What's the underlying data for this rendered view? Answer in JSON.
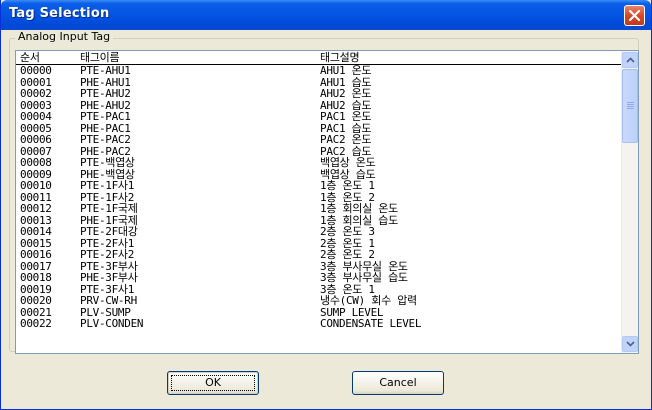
{
  "window": {
    "title": "Tag Selection"
  },
  "group": {
    "label": "Analog Input Tag"
  },
  "list": {
    "columns": [
      "순서",
      "태그이름",
      "태그설명"
    ],
    "rows": [
      [
        "00000",
        "PTE-AHU1",
        "AHU1 온도"
      ],
      [
        "00001",
        "PHE-AHU1",
        "AHU1 습도"
      ],
      [
        "00002",
        "PTE-AHU2",
        "AHU2 온도"
      ],
      [
        "00003",
        "PHE-AHU2",
        "AHU2 습도"
      ],
      [
        "00004",
        "PTE-PAC1",
        "PAC1 온도"
      ],
      [
        "00005",
        "PHE-PAC1",
        "PAC1 습도"
      ],
      [
        "00006",
        "PTE-PAC2",
        "PAC2 온도"
      ],
      [
        "00007",
        "PHE-PAC2",
        "PAC2 습도"
      ],
      [
        "00008",
        "PTE-백엽상",
        "백엽상 온도"
      ],
      [
        "00009",
        "PHE-백엽상",
        "백엽상 습도"
      ],
      [
        "00010",
        "PTE-1F사1",
        "1층 온도 1"
      ],
      [
        "00011",
        "PTE-1F사2",
        "1층 온도 2"
      ],
      [
        "00012",
        "PTE-1F국제",
        "1층 회의실 온도"
      ],
      [
        "00013",
        "PHE-1F국제",
        "1층 회의실 습도"
      ],
      [
        "00014",
        "PTE-2F대강",
        "2층 온도 3"
      ],
      [
        "00015",
        "PTE-2F사1",
        "2층 온도 1"
      ],
      [
        "00016",
        "PTE-2F사2",
        "2층 온도 2"
      ],
      [
        "00017",
        "PTE-3F부사",
        "3층 부사무실 온도"
      ],
      [
        "00018",
        "PHE-3F부사",
        "3층 부사무실 습도"
      ],
      [
        "00019",
        "PTE-3F사1",
        "3층 온도 1"
      ],
      [
        "00020",
        "PRV-CW-RH",
        "냉수(CW) 회수 압력"
      ],
      [
        "00021",
        "PLV-SUMP",
        "SUMP LEVEL"
      ],
      [
        "00022",
        "PLV-CONDEN",
        "CONDENSATE LEVEL"
      ]
    ]
  },
  "buttons": {
    "ok": "OK",
    "cancel": "Cancel"
  },
  "colors": {
    "titlebar": "#0554e3",
    "close": "#d7482a",
    "dialog_bg": "#ece9d8"
  },
  "icons": {
    "close": "close-icon",
    "scroll_up": "chevron-up-icon",
    "scroll_down": "chevron-down-icon"
  }
}
